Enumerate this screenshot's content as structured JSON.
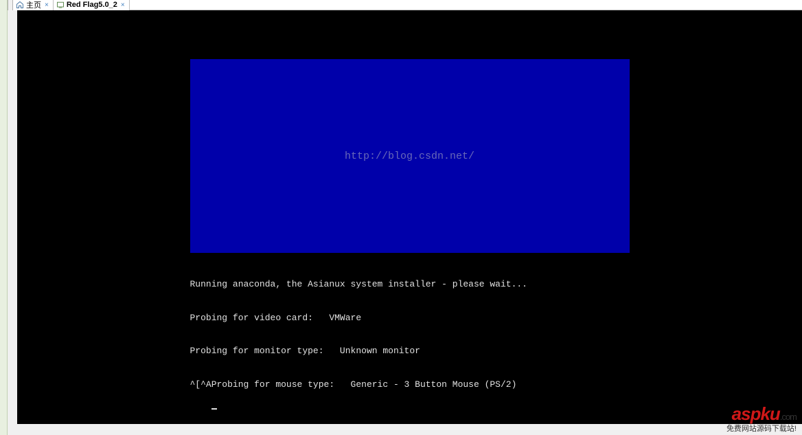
{
  "tabs": [
    {
      "label": "主页",
      "icon": "home"
    },
    {
      "label": "Red Flag5.0_2",
      "icon": "vm"
    }
  ],
  "blue_screen": {
    "watermark": "http://blog.csdn.net/"
  },
  "console": {
    "line1": "Running anaconda, the Asianux system installer - please wait...",
    "line2": "Probing for video card:   VMWare",
    "line3": "Probing for monitor type:   Unknown monitor",
    "line4": "^[^AProbing for mouse type:   Generic - 3 Button Mouse (PS/2)"
  },
  "footer_logo": {
    "brand": "aspku",
    "tld": ".com",
    "tagline": "免费网站源码下载站!"
  }
}
